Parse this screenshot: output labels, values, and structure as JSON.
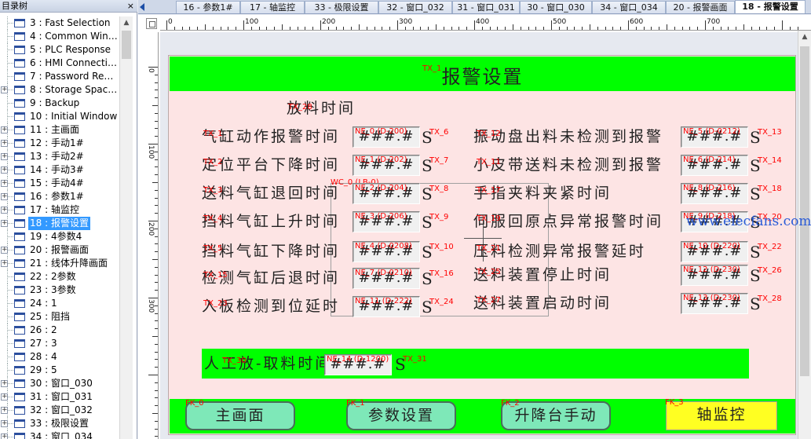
{
  "left_panel": {
    "title": "目录树",
    "close": "×",
    "items": [
      {
        "label": "3 : Fast Selection",
        "plus": false
      },
      {
        "label": "4 : Common Win…",
        "plus": false
      },
      {
        "label": "5 : PLC Response",
        "plus": false
      },
      {
        "label": "6 : HMI Connecti…",
        "plus": false
      },
      {
        "label": "7 : Password Re…",
        "plus": false
      },
      {
        "label": "8 : Storage Spac…",
        "plus": true
      },
      {
        "label": "9 : Backup",
        "plus": false
      },
      {
        "label": "10 : Initial Window",
        "plus": false
      },
      {
        "label": "11 : 主画面",
        "plus": true
      },
      {
        "label": "12 : 手动1#",
        "plus": true
      },
      {
        "label": "13 : 手动2#",
        "plus": true
      },
      {
        "label": "14 : 手动3#",
        "plus": true
      },
      {
        "label": "15 : 手动4#",
        "plus": true
      },
      {
        "label": "16 : 参数1#",
        "plus": true
      },
      {
        "label": "17 : 轴监控",
        "plus": true
      },
      {
        "label": "18 : 报警设置",
        "plus": true,
        "selected": true
      },
      {
        "label": "19 : 4参数4",
        "plus": false
      },
      {
        "label": "20 : 报警画面",
        "plus": true
      },
      {
        "label": "21 : 线体升降画面",
        "plus": true
      },
      {
        "label": "22 : 2参数",
        "plus": false
      },
      {
        "label": "23 : 3参数",
        "plus": false
      },
      {
        "label": "24 : 1",
        "plus": false
      },
      {
        "label": "25 : 阻挡",
        "plus": false
      },
      {
        "label": "26 : 2",
        "plus": false
      },
      {
        "label": "27 : 3",
        "plus": false
      },
      {
        "label": "28 : 4",
        "plus": false
      },
      {
        "label": "29 : 5",
        "plus": false
      },
      {
        "label": "30 : 窗口_030",
        "plus": true
      },
      {
        "label": "31 : 窗口_031",
        "plus": true
      },
      {
        "label": "32 : 窗口_032",
        "plus": true
      },
      {
        "label": "33 : 极限设置",
        "plus": true
      },
      {
        "label": "34 : 窗口_034",
        "plus": true
      }
    ]
  },
  "tabs": [
    {
      "label": "16 - 参数1#",
      "active": false
    },
    {
      "label": "17 - 轴监控",
      "active": false
    },
    {
      "label": "33 - 极限设置",
      "active": false
    },
    {
      "label": "32 - 窗口_032",
      "active": false
    },
    {
      "label": "31 - 窗口_031",
      "active": false
    },
    {
      "label": "30 - 窗口_030",
      "active": false
    },
    {
      "label": "34 - 窗口_034",
      "active": false
    },
    {
      "label": "20 - 报警画面",
      "active": false
    },
    {
      "label": "18 - 报警设置",
      "active": true
    }
  ],
  "ruler": {
    "h_labels": [
      "0",
      "100",
      "200",
      "300",
      "400",
      "500",
      "600",
      "700"
    ],
    "v_labels": [
      "0",
      "100",
      "200",
      "300"
    ]
  },
  "screen": {
    "title": "报警设置",
    "title_tag": "TX_1",
    "subtitle": "放料时间",
    "subtitle_tag": "TX_28",
    "frame_label": "WC_0 (LB-0)",
    "left_rows": [
      {
        "label": "气缸动作报警时间",
        "tag": "TX_1",
        "num_tag": "NE_0 (D-200)",
        "value": "###.#",
        "unit": "S",
        "unit_tag": "TX_6"
      },
      {
        "label": "定位平台下降时间",
        "tag": "TX_2",
        "num_tag": "NE_1 (D-202)",
        "value": "###.#",
        "unit": "S",
        "unit_tag": "TX_7"
      },
      {
        "label": "送料气缸退回时间",
        "tag": "TX_3",
        "num_tag": "NE_2 (D-204)",
        "value": "###.#",
        "unit": "S",
        "unit_tag": "TX_8"
      },
      {
        "label": "挡料气缸上升时间",
        "tag": "TX_4",
        "num_tag": "NE_3 (D-206)",
        "value": "###.#",
        "unit": "S",
        "unit_tag": "TX_9"
      },
      {
        "label": "挡料气缸下降时间",
        "tag": "TX_5",
        "num_tag": "NE_4 (D-0208)",
        "value": "###.#",
        "unit": "S",
        "unit_tag": "TX_10"
      },
      {
        "label": "检测气缸后退时间",
        "tag": "TX_15",
        "num_tag": "NE_7 (D-0210)",
        "value": "###.#",
        "unit": "S",
        "unit_tag": "TX_16"
      },
      {
        "label": "入板检测到位延时",
        "tag": "TX_23",
        "num_tag": "NE_11 (D-222)",
        "value": "###.#",
        "unit": "S",
        "unit_tag": "TX_24"
      }
    ],
    "right_rows": [
      {
        "label": "振动盘出料未检测到报警",
        "tag": "TX_12",
        "num_tag": "NE_5 (D-0212)",
        "value": "###.#",
        "unit": "S",
        "unit_tag": "TX_13"
      },
      {
        "label": "小皮带送料未检测到报警",
        "tag": "TX_11",
        "num_tag": "NE_6 (D-214)",
        "value": "###.#",
        "unit": "S",
        "unit_tag": "TX_14"
      },
      {
        "label": "手指夹料夹紧时间",
        "tag": "TX_17",
        "num_tag": "NE_8 (D-216)",
        "value": "###.#",
        "unit": "S",
        "unit_tag": "TX_18"
      },
      {
        "label": "伺服回原点异常报警时间",
        "tag": "TX_19",
        "num_tag": "NE_9 (D-218)",
        "value": "###.#",
        "unit": "S",
        "unit_tag": "TX_20"
      },
      {
        "label": "压料检测异常报警延时",
        "tag": "TX_21",
        "num_tag": "NE_10 (D-220)",
        "value": "###.#",
        "unit": "S",
        "unit_tag": "TX_22"
      },
      {
        "label": "送料装置停止时间",
        "tag": "TX_25",
        "num_tag": "NE_12 (D-230)",
        "value": "###.#",
        "unit": "S",
        "unit_tag": "TX_26"
      },
      {
        "label": "送料装置启动时间",
        "tag": "TX_27",
        "num_tag": "NE_13 (D-230)",
        "value": "###.#",
        "unit": "S",
        "unit_tag": "TX_28"
      }
    ],
    "bottom_row": {
      "label": "人工放-取料时间",
      "tag": "TX_30",
      "num_tag": "NE_14 (D-1200)",
      "value": "###.#",
      "unit": "S",
      "unit_tag": "TX_31"
    },
    "nav": [
      {
        "label": "主画面",
        "tag": "FK_0"
      },
      {
        "label": "参数设置",
        "tag": "FK_1"
      },
      {
        "label": "升降台手动",
        "tag": "FK_2"
      },
      {
        "label": "轴监控",
        "tag": "FK_3"
      }
    ],
    "watermark": "www.elecfans.com"
  },
  "colors": {
    "green": "#00ff00",
    "screen_bg": "#fde4e4",
    "tag_red": "#ff0000",
    "nav_button": "#7ee8b8",
    "nav_yellow": "#ffff22",
    "selection": "#3399ff"
  },
  "icons": [
    "window-icon",
    "expand-icon",
    "close-icon",
    "tab-scroll-left-icon"
  ]
}
